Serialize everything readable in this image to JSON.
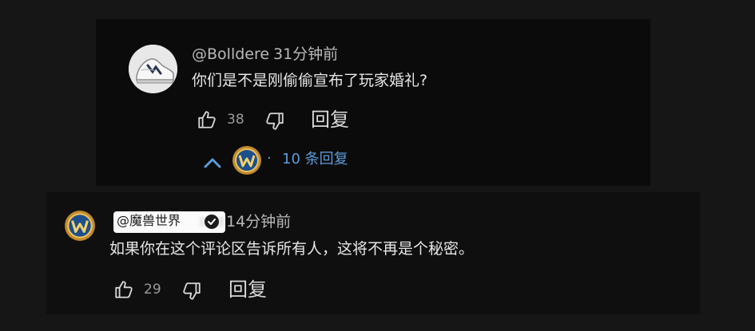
{
  "comments": [
    {
      "username": "@Bolldere",
      "time": "31分钟前",
      "text": "你们是不是刚偷偷宣布了玩家婚礼?",
      "likes": "38",
      "reply_label": "回复",
      "replies_label": "10 条回复",
      "replies_separator": "·",
      "avatar_icon": "sneaker-avatar"
    },
    {
      "username": "@魔兽世界",
      "time": "14分钟前",
      "text": "如果你在这个评论区告诉所有人，这将不再是个秘密。",
      "likes": "29",
      "reply_label": "回复",
      "verified_icon": "check-icon",
      "avatar_icon": "wow-logo-icon"
    }
  ],
  "colors": {
    "background": "#161616",
    "panel": "#0b0b0b",
    "link": "#5b9bd8",
    "text": "#e6e6e6"
  }
}
